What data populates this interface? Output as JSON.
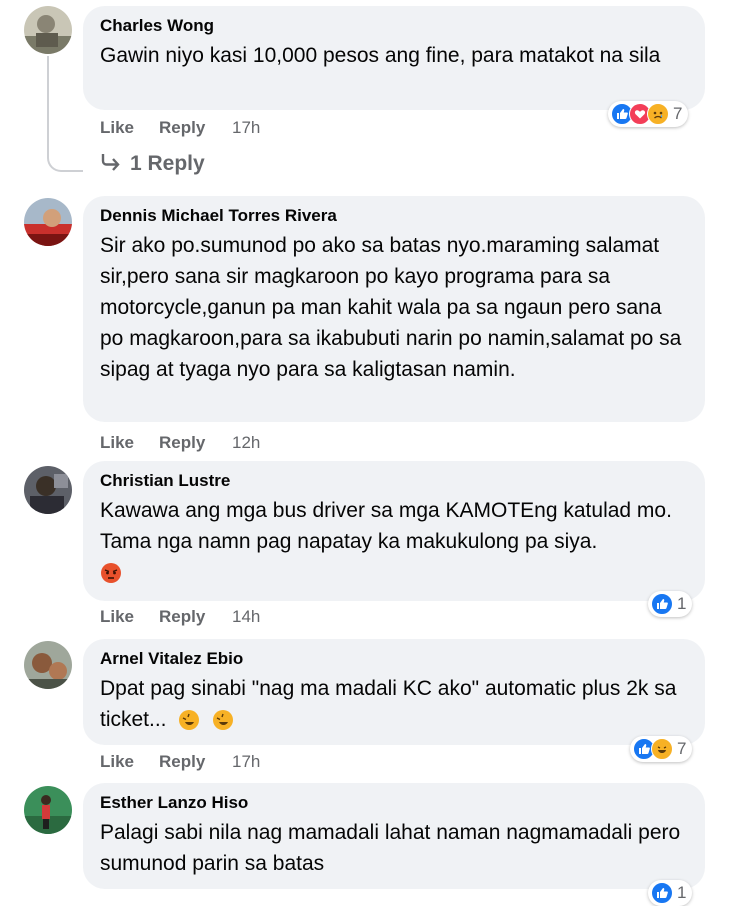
{
  "comments": [
    {
      "author": "Charles Wong",
      "text": "Gawin niyo kasi 10,000 pesos ang fine, para matakot na sila",
      "like": "Like",
      "reply": "Reply",
      "time": "17h",
      "reaction_count": "7",
      "reactions": [
        "like-icon",
        "love-icon",
        "sad-icon"
      ],
      "replies_label": "1 Reply"
    },
    {
      "author": "Dennis Michael Torres Rivera",
      "text": "Sir ako po.sumunod po ako sa batas nyo.maraming salamat sir,pero sana sir magkaroon po kayo programa para sa motorcycle,ganun pa man kahit wala pa sa ngaun pero sana po magkaroon,para sa ikabubuti narin po namin,salamat po sa sipag at tyaga nyo para sa kaligtasan namin.",
      "like": "Like",
      "reply": "Reply",
      "time": "12h"
    },
    {
      "author": "Christian Lustre",
      "text": "Kawawa ang mga bus driver sa mga KAMOTEng katulad mo. Tama nga namn pag napatay ka makukulong pa siya.",
      "like": "Like",
      "reply": "Reply",
      "time": "14h",
      "reaction_count": "1",
      "reactions": [
        "like-icon"
      ]
    },
    {
      "author": "Arnel Vitalez Ebio",
      "text": "Dpat pag sinabi \"nag ma madali KC ako\" automatic plus 2k sa ticket...",
      "like": "Like",
      "reply": "Reply",
      "time": "17h",
      "reaction_count": "7",
      "reactions": [
        "like-icon",
        "haha-icon"
      ]
    },
    {
      "author": "Esther Lanzo Hiso",
      "text": "Palagi sabi nila nag mamadali lahat naman nagmamadali pero sumunod parin sa batas",
      "reaction_count": "1",
      "reactions": [
        "like-icon"
      ]
    }
  ],
  "colors": {
    "bubble": "#f0f2f5",
    "meta": "#65676b",
    "like_blue": "#1877f2",
    "love_red": "#f33e58",
    "haha_yellow": "#f7b125"
  }
}
